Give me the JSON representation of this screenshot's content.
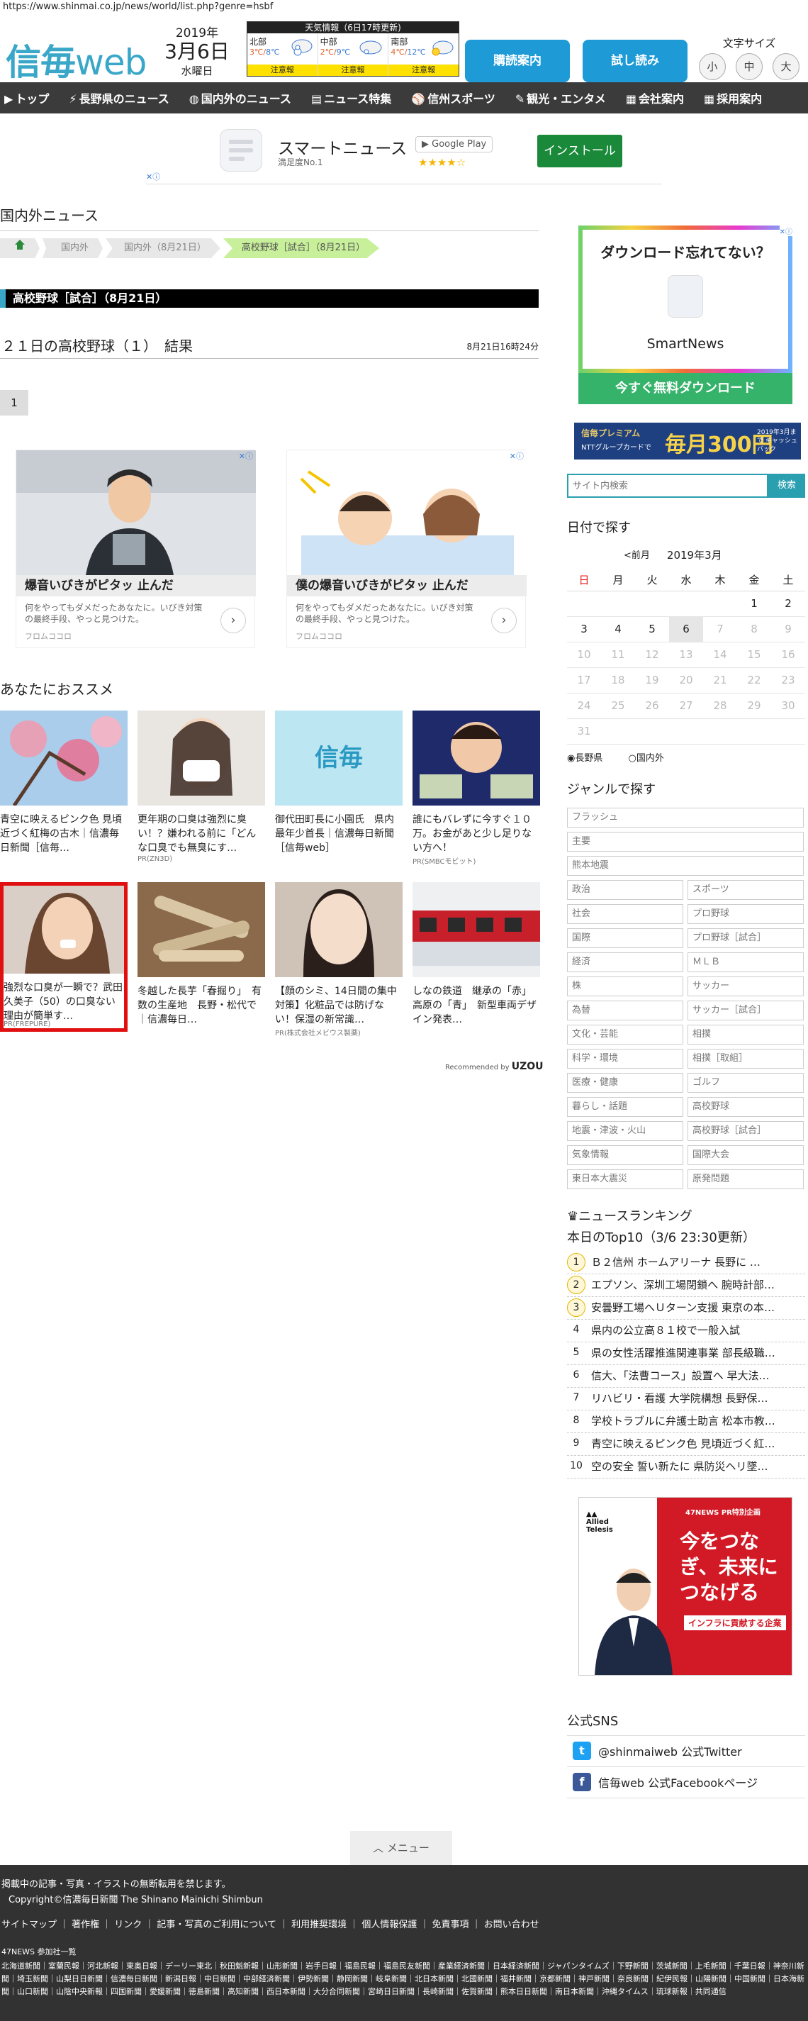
{
  "browser": {
    "url": "https://www.shinmai.co.jp/news/world/list.php?genre=hsbf"
  },
  "header": {
    "logo_main": "信毎",
    "logo_web": "web",
    "year": "2019年",
    "month_day": "3月6日",
    "weekday": "水曜日",
    "weather_title": "天気情報（6日17時更新)",
    "regions": [
      {
        "name": "北部",
        "hi": "3℃",
        "lo": "8℃",
        "alert": "注意報"
      },
      {
        "name": "中部",
        "hi": "2℃",
        "lo": "9℃",
        "alert": "注意報"
      },
      {
        "name": "南部",
        "hi": "4℃",
        "lo": "12℃",
        "alert": "注意報"
      }
    ],
    "subscribe": "購読案内",
    "trial": "試し読み",
    "font_size_label": "文字サイズ",
    "font_sizes": [
      "小",
      "中",
      "大"
    ]
  },
  "nav": [
    {
      "icon": "▶",
      "label": "トップ"
    },
    {
      "icon": "⚡",
      "label": "長野県のニュース"
    },
    {
      "icon": "◍",
      "label": "国内外のニュース"
    },
    {
      "icon": "▤",
      "label": "ニュース特集"
    },
    {
      "icon": "⚾",
      "label": "信州スポーツ"
    },
    {
      "icon": "✎",
      "label": "観光・エンタメ"
    },
    {
      "icon": "▦",
      "label": "会社案内"
    },
    {
      "icon": "▦",
      "label": "採用案内"
    }
  ],
  "top_ad": {
    "app_name": "スマートニュース",
    "app_sub": "満足度No.1",
    "store": "Google Play",
    "stars": "★★★★☆",
    "install": "インストール",
    "adchoice": "✕ⓘ"
  },
  "main": {
    "section_title": "国内外ニュース",
    "breadcrumbs": [
      "国内外",
      "国内外（8月21日）",
      "高校野球［試合］（8月21日）"
    ],
    "page_head": "高校野球［試合］（8月21日）",
    "article_title": "２１日の高校野球（１）　結果",
    "article_time": "8月21日16時24分",
    "page": "1"
  },
  "native_ads": [
    {
      "title": "爆音いびきがピタッ 止んだ",
      "desc": "何をやってもダメだったあなたに。いびき対策の最終手段、やっと見つけた。",
      "src": "フロムココロ",
      "arrow": "›",
      "adx": "✕ⓘ"
    },
    {
      "title": "僕の爆音いびきがピタッ 止んだ",
      "desc": "何をやってもダメだったあなたに。いびき対策の最終手段、やっと見つけた。",
      "src": "フロムココロ",
      "arrow": "›",
      "adx": "✕ⓘ"
    }
  ],
  "recommend": {
    "title": "あなたにおススメ",
    "items": [
      {
        "text": "青空に映えるピンク色 見頃近づく紅梅の古木｜信濃毎日新聞［信毎…",
        "pr": ""
      },
      {
        "text": "更年期の口臭は強烈に臭い！？嫌われる前に「どんな口臭でも無臭にす…",
        "pr": "PR(ZN3D)"
      },
      {
        "text": "御代田町長に小園氏　県内最年少首長｜信濃毎日新聞［信毎web］",
        "pr": ""
      },
      {
        "text": "誰にもバレずに今すぐ１０万。お金があと少し足りない方へ！",
        "pr": "PR(SMBCモビット)"
      },
      {
        "text": "強烈な口臭が一瞬で？武田久美子（50）の口臭ない理由が簡単す…",
        "pr": "PR(FREPURE)"
      },
      {
        "text": "冬越した長芋「春掘り」　有数の生産地　長野・松代で｜信濃毎日…",
        "pr": ""
      },
      {
        "text": "【顔のシミ、14日間の集中対策】化粧品では防げない！保湿の新常識…",
        "pr": "PR(株式会社メビウス製薬)"
      },
      {
        "text": "しなの鉄道　継承の「赤」　高原の「青」　新型車両デザイン発表…",
        "pr": ""
      }
    ],
    "recommended_by": "Recommended by",
    "uzou": "UZOU"
  },
  "sidebar": {
    "sn_ad": {
      "title": "ダウンロード忘れてない？",
      "brand": "SmartNews",
      "cta": "今すぐ無料ダウンロード",
      "adx": "✕ⓘ"
    },
    "premium_ad": {
      "p1": "信毎プレミアム",
      "p2": "NTTグループカードで",
      "p3": "毎月300円",
      "p4": "2019年3月まで キャッシュバック"
    },
    "search_placeholder": "サイト内検索",
    "search_button": "検索",
    "calendar_title": "日付で探す",
    "cal_prev": "<前月",
    "cal_month": "2019年3月",
    "weekdays": [
      "日",
      "月",
      "火",
      "水",
      "木",
      "金",
      "土"
    ],
    "weeks": [
      [
        "",
        "",
        "",
        "",
        "",
        "1",
        "2"
      ],
      [
        "3",
        "4",
        "5",
        "6",
        "7",
        "8",
        "9"
      ],
      [
        "10",
        "11",
        "12",
        "13",
        "14",
        "15",
        "16"
      ],
      [
        "17",
        "18",
        "19",
        "20",
        "21",
        "22",
        "23"
      ],
      [
        "24",
        "25",
        "26",
        "27",
        "28",
        "29",
        "30"
      ],
      [
        "31",
        "",
        "",
        "",
        "",
        "",
        ""
      ]
    ],
    "radio_nagano": "長野県",
    "radio_world": "国内外",
    "genre_title": "ジャンルで探す",
    "genres_full": [
      "フラッシュ",
      "主要",
      "熊本地震"
    ],
    "genres_left": [
      "政治",
      "社会",
      "国際",
      "経済",
      "株",
      "為替",
      "文化・芸能",
      "科学・環境",
      "医療・健康",
      "暮らし・話題",
      "地震・津波・火山",
      "気象情報",
      "東日本大震災"
    ],
    "genres_right": [
      "スポーツ",
      "プロ野球",
      "プロ野球［試合］",
      "ＭＬＢ",
      "サッカー",
      "サッカー［試合］",
      "相撲",
      "相撲［取組］",
      "ゴルフ",
      "高校野球",
      "高校野球［試合］",
      "国際大会",
      "原発問題"
    ],
    "ranking_title": "ニュースランキング",
    "ranking_sub": "本日のTop10（3/6 23:30更新）",
    "ranking": [
      "Ｂ２信州 ホームアリーナ 長野に …",
      "エプソン、深圳工場閉鎖へ 腕時計部…",
      "安曇野工場へＵターン支援 東京の本…",
      "県内の公立高８１校で一般入試",
      "県の女性活躍推進関連事業 部長級職…",
      "信大、「法曹コース」設置へ 早大法…",
      "リハビリ・看護 大学院構想 長野保…",
      "学校トラブルに弁護士助言 松本市教…",
      "青空に映えるピンク色 見頃近づく紅…",
      "空の安全 誓い新たに 県防災ヘリ墜…"
    ],
    "allied_ad": {
      "logo": "Allied Telesis",
      "tag": "47NEWS PR特別企画",
      "text": "今をつなぎ、未来につなげる",
      "sub": "インフラに貢献する企業"
    },
    "sns_title": "公式SNS",
    "twitter": "@shinmaiweb 公式Twitter",
    "facebook": "信毎web 公式Facebookページ"
  },
  "footer": {
    "menu": "メニュー",
    "notice": "掲載中の記事・写真・イラストの無断転用を禁じます。",
    "copyright": "Copyright©信濃毎日新聞 The Shinano Mainichi Shimbun",
    "links": [
      "サイトマップ",
      "著作権",
      "リンク",
      "記事・写真のご利用について",
      "利用推奨環境",
      "個人情報保護",
      "免責事項",
      "お問い合わせ"
    ],
    "news47": "47NEWS 参加社一覧",
    "papers": "北海道新聞｜室蘭民報｜河北新報｜東奥日報｜デーリー東北｜秋田魁新報｜山形新聞｜岩手日報｜福島民報｜福島民友新聞｜産業経済新聞｜日本経済新聞｜ジャパンタイムズ｜下野新聞｜茨城新聞｜上毛新聞｜千葉日報｜神奈川新聞｜埼玉新聞｜山梨日日新聞｜信濃毎日新聞｜新潟日報｜中日新聞｜中部経済新聞｜伊勢新聞｜静岡新聞｜岐阜新聞｜北日本新聞｜北國新聞｜福井新聞｜京都新聞｜神戸新聞｜奈良新聞｜紀伊民報｜山陽新聞｜中国新聞｜日本海新聞｜山口新聞｜山陰中央新報｜四国新聞｜愛媛新聞｜徳島新聞｜高知新聞｜西日本新聞｜大分合同新聞｜宮崎日日新聞｜長崎新聞｜佐賀新聞｜熊本日日新聞｜南日本新聞｜沖縄タイムス｜琉球新報｜共同通信"
  }
}
